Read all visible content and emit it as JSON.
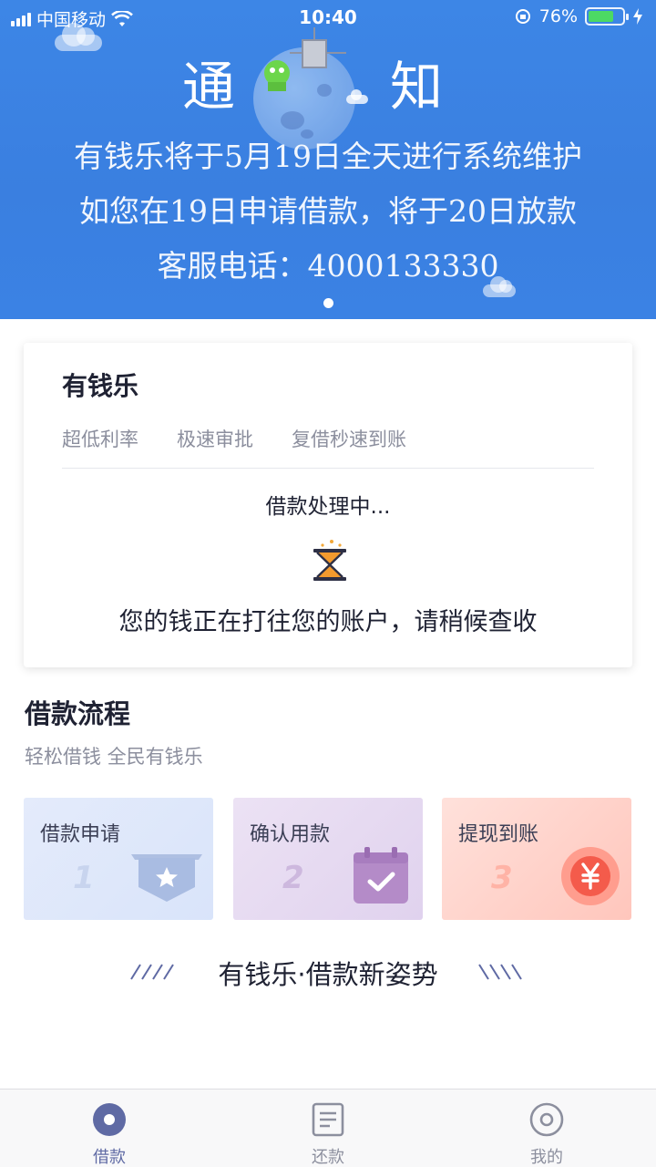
{
  "status_bar": {
    "carrier": "中国移动",
    "time": "10:40",
    "battery_percent": "76%",
    "battery_level": 0.76,
    "icons": [
      "signal-icon",
      "wifi-icon",
      "rotation-lock-icon",
      "battery-icon",
      "charging-icon"
    ]
  },
  "banner": {
    "title_left": "通",
    "title_right": "知",
    "lines": [
      "有钱乐将于5月19日全天进行系统维护",
      "如您在19日申请借款，将于20日放款",
      "客服电话：4000133330"
    ],
    "background": "#3b82e4"
  },
  "card": {
    "title": "有钱乐",
    "tags": [
      "超低利率",
      "极速审批",
      "复借秒速到账"
    ],
    "status": "借款处理中...",
    "description": "您的钱正在打往您的账户，请稍候查收",
    "status_icon": "hourglass-icon"
  },
  "process": {
    "title": "借款流程",
    "subtitle": "轻松借钱  全民有钱乐",
    "steps": [
      {
        "label": "借款申请",
        "number": "1",
        "icon": "badge-star-icon"
      },
      {
        "label": "确认用款",
        "number": "2",
        "icon": "calendar-check-icon"
      },
      {
        "label": "提现到账",
        "number": "3",
        "icon": "yen-coin-icon"
      }
    ]
  },
  "slogan": "有钱乐·借款新姿势",
  "tabbar": {
    "tabs": [
      {
        "label": "借款",
        "icon": "loan-icon",
        "active": true
      },
      {
        "label": "还款",
        "icon": "repay-document-icon",
        "active": false
      },
      {
        "label": "我的",
        "icon": "profile-icon",
        "active": false
      }
    ],
    "active_color": "#5f6aa4"
  }
}
